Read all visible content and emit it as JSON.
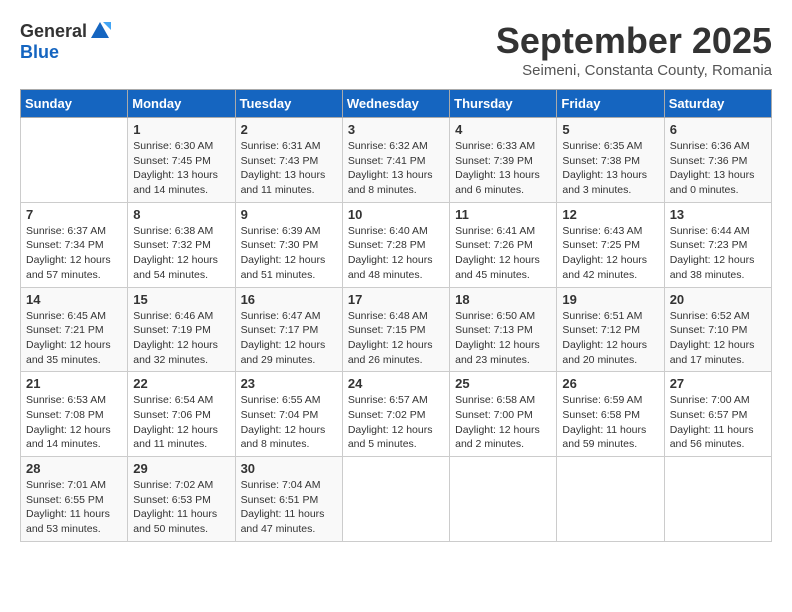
{
  "logo": {
    "line1": "General",
    "line2": "Blue"
  },
  "title": "September 2025",
  "subtitle": "Seimeni, Constanta County, Romania",
  "header": {
    "days": [
      "Sunday",
      "Monday",
      "Tuesday",
      "Wednesday",
      "Thursday",
      "Friday",
      "Saturday"
    ]
  },
  "weeks": [
    [
      {
        "day": "",
        "content": ""
      },
      {
        "day": "1",
        "content": "Sunrise: 6:30 AM\nSunset: 7:45 PM\nDaylight: 13 hours\nand 14 minutes."
      },
      {
        "day": "2",
        "content": "Sunrise: 6:31 AM\nSunset: 7:43 PM\nDaylight: 13 hours\nand 11 minutes."
      },
      {
        "day": "3",
        "content": "Sunrise: 6:32 AM\nSunset: 7:41 PM\nDaylight: 13 hours\nand 8 minutes."
      },
      {
        "day": "4",
        "content": "Sunrise: 6:33 AM\nSunset: 7:39 PM\nDaylight: 13 hours\nand 6 minutes."
      },
      {
        "day": "5",
        "content": "Sunrise: 6:35 AM\nSunset: 7:38 PM\nDaylight: 13 hours\nand 3 minutes."
      },
      {
        "day": "6",
        "content": "Sunrise: 6:36 AM\nSunset: 7:36 PM\nDaylight: 13 hours\nand 0 minutes."
      }
    ],
    [
      {
        "day": "7",
        "content": "Sunrise: 6:37 AM\nSunset: 7:34 PM\nDaylight: 12 hours\nand 57 minutes."
      },
      {
        "day": "8",
        "content": "Sunrise: 6:38 AM\nSunset: 7:32 PM\nDaylight: 12 hours\nand 54 minutes."
      },
      {
        "day": "9",
        "content": "Sunrise: 6:39 AM\nSunset: 7:30 PM\nDaylight: 12 hours\nand 51 minutes."
      },
      {
        "day": "10",
        "content": "Sunrise: 6:40 AM\nSunset: 7:28 PM\nDaylight: 12 hours\nand 48 minutes."
      },
      {
        "day": "11",
        "content": "Sunrise: 6:41 AM\nSunset: 7:26 PM\nDaylight: 12 hours\nand 45 minutes."
      },
      {
        "day": "12",
        "content": "Sunrise: 6:43 AM\nSunset: 7:25 PM\nDaylight: 12 hours\nand 42 minutes."
      },
      {
        "day": "13",
        "content": "Sunrise: 6:44 AM\nSunset: 7:23 PM\nDaylight: 12 hours\nand 38 minutes."
      }
    ],
    [
      {
        "day": "14",
        "content": "Sunrise: 6:45 AM\nSunset: 7:21 PM\nDaylight: 12 hours\nand 35 minutes."
      },
      {
        "day": "15",
        "content": "Sunrise: 6:46 AM\nSunset: 7:19 PM\nDaylight: 12 hours\nand 32 minutes."
      },
      {
        "day": "16",
        "content": "Sunrise: 6:47 AM\nSunset: 7:17 PM\nDaylight: 12 hours\nand 29 minutes."
      },
      {
        "day": "17",
        "content": "Sunrise: 6:48 AM\nSunset: 7:15 PM\nDaylight: 12 hours\nand 26 minutes."
      },
      {
        "day": "18",
        "content": "Sunrise: 6:50 AM\nSunset: 7:13 PM\nDaylight: 12 hours\nand 23 minutes."
      },
      {
        "day": "19",
        "content": "Sunrise: 6:51 AM\nSunset: 7:12 PM\nDaylight: 12 hours\nand 20 minutes."
      },
      {
        "day": "20",
        "content": "Sunrise: 6:52 AM\nSunset: 7:10 PM\nDaylight: 12 hours\nand 17 minutes."
      }
    ],
    [
      {
        "day": "21",
        "content": "Sunrise: 6:53 AM\nSunset: 7:08 PM\nDaylight: 12 hours\nand 14 minutes."
      },
      {
        "day": "22",
        "content": "Sunrise: 6:54 AM\nSunset: 7:06 PM\nDaylight: 12 hours\nand 11 minutes."
      },
      {
        "day": "23",
        "content": "Sunrise: 6:55 AM\nSunset: 7:04 PM\nDaylight: 12 hours\nand 8 minutes."
      },
      {
        "day": "24",
        "content": "Sunrise: 6:57 AM\nSunset: 7:02 PM\nDaylight: 12 hours\nand 5 minutes."
      },
      {
        "day": "25",
        "content": "Sunrise: 6:58 AM\nSunset: 7:00 PM\nDaylight: 12 hours\nand 2 minutes."
      },
      {
        "day": "26",
        "content": "Sunrise: 6:59 AM\nSunset: 6:58 PM\nDaylight: 11 hours\nand 59 minutes."
      },
      {
        "day": "27",
        "content": "Sunrise: 7:00 AM\nSunset: 6:57 PM\nDaylight: 11 hours\nand 56 minutes."
      }
    ],
    [
      {
        "day": "28",
        "content": "Sunrise: 7:01 AM\nSunset: 6:55 PM\nDaylight: 11 hours\nand 53 minutes."
      },
      {
        "day": "29",
        "content": "Sunrise: 7:02 AM\nSunset: 6:53 PM\nDaylight: 11 hours\nand 50 minutes."
      },
      {
        "day": "30",
        "content": "Sunrise: 7:04 AM\nSunset: 6:51 PM\nDaylight: 11 hours\nand 47 minutes."
      },
      {
        "day": "",
        "content": ""
      },
      {
        "day": "",
        "content": ""
      },
      {
        "day": "",
        "content": ""
      },
      {
        "day": "",
        "content": ""
      }
    ]
  ]
}
